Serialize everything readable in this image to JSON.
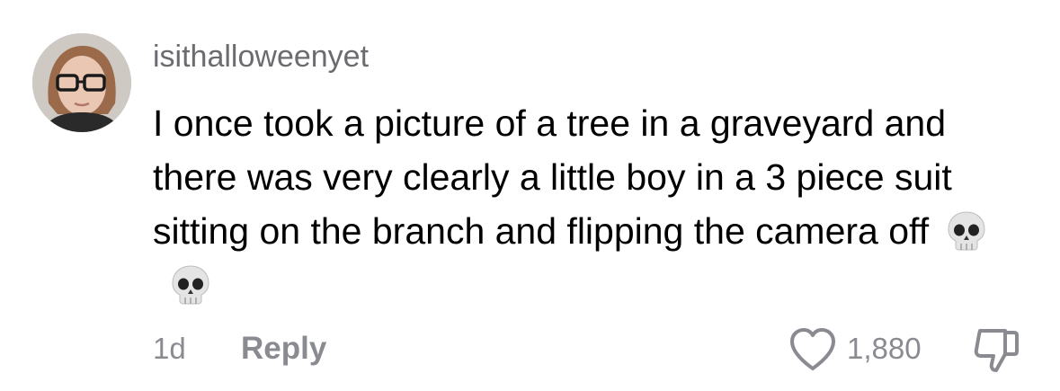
{
  "comment": {
    "username": "isithalloweenyet",
    "text": "I once took a picture of a tree in a graveyard and there was very clearly a little boy in a 3 piece suit sitting on the branch and flipping the camera off",
    "emojis": [
      "skull-emoji",
      "skull-emoji"
    ],
    "time_ago": "1d",
    "reply_label": "Reply",
    "like_count": "1,880",
    "icons": {
      "like": "heart-icon",
      "dislike": "thumbs-down-icon"
    },
    "colors": {
      "text": "#000000",
      "secondary": "#8a8b91"
    }
  }
}
